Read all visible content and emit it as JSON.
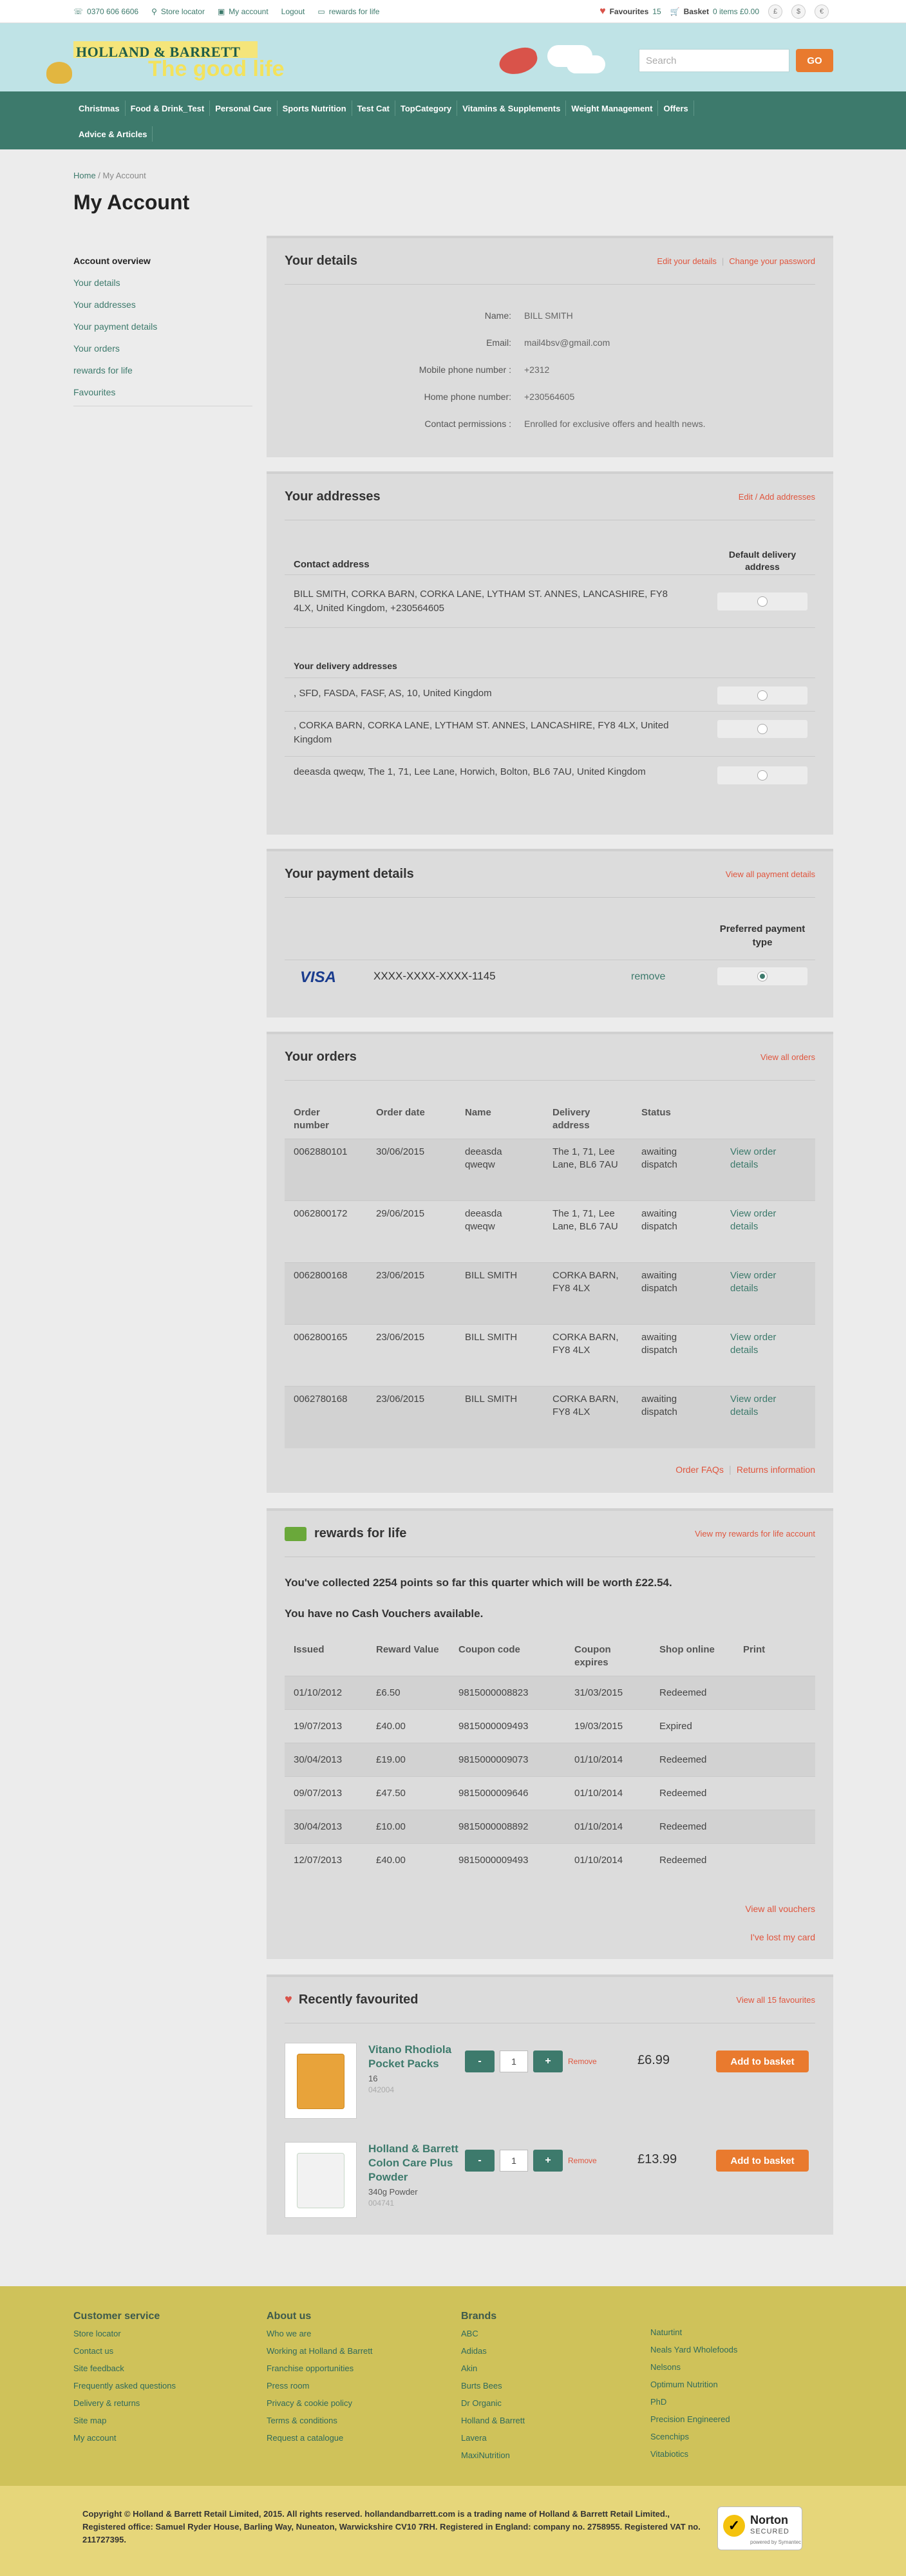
{
  "topbar": {
    "phone": "0370 606 6606",
    "store_locator": "Store locator",
    "my_account": "My account",
    "logout": "Logout",
    "rewards": "rewards for life",
    "favourites_label": "Favourites",
    "favourites_count": "15",
    "basket_label": "Basket",
    "basket_summary": "0 items £0.00",
    "currency_1": "£",
    "currency_2": "$",
    "currency_3": "€"
  },
  "header": {
    "logo": "HOLLAND & BARRETT",
    "tagline": "The good life",
    "search_placeholder": "Search",
    "go": "GO"
  },
  "nav": {
    "row1": [
      "Christmas",
      "Food & Drink_Test",
      "Personal Care",
      "Sports Nutrition",
      "Test Cat",
      "TopCategory",
      "Vitamins & Supplements",
      "Weight Management",
      "Offers"
    ],
    "row2": [
      "Advice & Articles"
    ]
  },
  "breadcrumb": {
    "home": "Home",
    "sep": " / ",
    "current": "My Account"
  },
  "page_title": "My Account",
  "sidebar": {
    "items": [
      "Account overview",
      "Your details",
      "Your addresses",
      "Your payment details",
      "Your orders",
      "rewards for life",
      "Favourites"
    ]
  },
  "details": {
    "title": "Your details",
    "edit": "Edit your details",
    "change_password": "Change your password",
    "rows": [
      {
        "label": "Name:",
        "value": "BILL SMITH"
      },
      {
        "label": "Email:",
        "value": "mail4bsv@gmail.com"
      },
      {
        "label": "Mobile phone number :",
        "value": "+2312"
      },
      {
        "label": "Home phone number:",
        "value": "+230564605"
      },
      {
        "label": "Contact permissions :",
        "value": "Enrolled for exclusive offers and health news."
      }
    ]
  },
  "addresses": {
    "title": "Your addresses",
    "edit": "Edit / Add addresses",
    "contact_heading": "Contact address",
    "default_heading": "Default delivery address",
    "contact_address": "BILL  SMITH,  CORKA BARN,  CORKA LANE,  LYTHAM ST. ANNES,  LANCASHIRE,  FY8 4LX,  United Kingdom,  +230564605",
    "delivery_heading": "Your delivery addresses",
    "delivery": [
      ",  SFD,  FASDA,  FASF,  AS,  10,  United Kingdom",
      ",  CORKA BARN,  CORKA LANE,  LYTHAM ST. ANNES,  LANCASHIRE,  FY8 4LX,  United Kingdom",
      "deeasda  qweqw,  The 1, 71, Lee Lane,  Horwich,  Bolton,  BL6 7AU,  United Kingdom"
    ]
  },
  "payment": {
    "title": "Your payment details",
    "view_all": "View all payment details",
    "preferred_heading": "Preferred payment type",
    "card_brand": "VISA",
    "card_number": "XXXX-XXXX-XXXX-1145",
    "remove": "remove"
  },
  "orders": {
    "title": "Your orders",
    "view_all": "View all orders",
    "headers": [
      "Order number",
      "Order date",
      "Name",
      "Delivery address",
      "Status",
      ""
    ],
    "rows": [
      [
        "0062880101",
        "30/06/2015",
        "deeasda qweqw",
        "The 1, 71, Lee Lane, BL6 7AU",
        "awaiting dispatch",
        "View order details"
      ],
      [
        "0062800172",
        "29/06/2015",
        "deeasda qweqw",
        "The 1, 71, Lee Lane, BL6 7AU",
        "awaiting dispatch",
        "View order details"
      ],
      [
        "0062800168",
        "23/06/2015",
        "BILL  SMITH",
        "CORKA BARN, FY8 4LX",
        "awaiting dispatch",
        "View order details"
      ],
      [
        "0062800165",
        "23/06/2015",
        "BILL  SMITH",
        "CORKA BARN, FY8 4LX",
        "awaiting dispatch",
        "View order details"
      ],
      [
        "0062780168",
        "23/06/2015",
        "BILL  SMITH",
        "CORKA BARN, FY8 4LX",
        "awaiting dispatch",
        "View order details"
      ]
    ],
    "faqs": "Order FAQs",
    "returns": "Returns information"
  },
  "rewards": {
    "title": "rewards for life",
    "view_account": "View my rewards for life account",
    "points_text": "You've collected 2254 points so far this quarter which will be worth £22.54.",
    "vouchers_text": "You have no Cash Vouchers available.",
    "headers": [
      "Issued",
      "Reward Value",
      "Coupon code",
      "Coupon expires",
      "Shop online",
      "Print"
    ],
    "rows": [
      [
        "01/10/2012",
        "£6.50",
        "9815000008823",
        "31/03/2015",
        "Redeemed",
        ""
      ],
      [
        "19/07/2013",
        "£40.00",
        "9815000009493",
        "19/03/2015",
        "Expired",
        ""
      ],
      [
        "30/04/2013",
        "£19.00",
        "9815000009073",
        "01/10/2014",
        "Redeemed",
        ""
      ],
      [
        "09/07/2013",
        "£47.50",
        "9815000009646",
        "01/10/2014",
        "Redeemed",
        ""
      ],
      [
        "30/04/2013",
        "£10.00",
        "9815000008892",
        "01/10/2014",
        "Redeemed",
        ""
      ],
      [
        "12/07/2013",
        "£40.00",
        "9815000009493",
        "01/10/2014",
        "Redeemed",
        ""
      ]
    ],
    "view_vouchers": "View all vouchers",
    "lost_card": "I've lost my card"
  },
  "favourites": {
    "title": "Recently favourited",
    "view_all": "View all 15 favourites",
    "items": [
      {
        "name": "Vitano Rhodiola Pocket Packs",
        "size": "16",
        "code": "042004",
        "qty": "1",
        "remove": "Remove",
        "price": "£6.99",
        "add": "Add to basket"
      },
      {
        "name": "Holland & Barrett Colon Care Plus Powder",
        "size": "340g   Powder",
        "code": "004741",
        "qty": "1",
        "remove": "Remove",
        "price": "£13.99",
        "add": "Add to basket"
      }
    ]
  },
  "footer": {
    "customer_service": {
      "title": "Customer service",
      "links": [
        "Store locator",
        "Contact us",
        "Site feedback",
        "Frequently asked questions",
        "Delivery & returns",
        "Site map",
        "My account"
      ]
    },
    "about_us": {
      "title": "About us",
      "links": [
        "Who we are",
        "Working at Holland & Barrett",
        "Franchise opportunities",
        "Press room",
        "Privacy & cookie policy",
        "Terms & conditions",
        "Request a catalogue"
      ]
    },
    "brands": {
      "title": "Brands",
      "links": [
        "ABC",
        "Adidas",
        "Akin",
        "Burts Bees",
        "Dr Organic",
        "Holland & Barrett",
        "Lavera",
        "MaxiNutrition"
      ]
    },
    "brands2": {
      "links": [
        "Naturtint",
        "Neals Yard Wholefoods",
        "Nelsons",
        "Optimum Nutrition",
        "PhD",
        "Precision Engineered",
        "Scenchips",
        "Vitabiotics"
      ]
    },
    "copyright": "Copyright © Holland & Barrett Retail Limited, 2015. All rights reserved. hollandandbarrett.com is a trading name of Holland & Barrett Retail Limited., Registered office: Samuel Ryder House, Barling Way, Nuneaton, Warwickshire CV10 7RH. Registered in England: company no. 2758955. Registered VAT no. 211727395.",
    "norton": "Norton",
    "norton_sub": "SECURED",
    "norton_by": "powered by Symantec"
  },
  "colors": {
    "brand_green": "#3d7a6c",
    "accent_orange": "#e97a2e",
    "link_red": "#e0553d",
    "footer_yellow": "#cfc25a"
  }
}
